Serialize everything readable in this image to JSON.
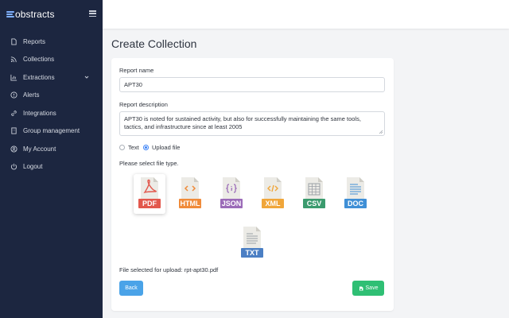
{
  "app": {
    "brand": "obstracts"
  },
  "sidebar": {
    "items": [
      {
        "label": "Reports",
        "icon": "file-icon"
      },
      {
        "label": "Collections",
        "icon": "rss-icon"
      },
      {
        "label": "Extractions",
        "icon": "flask-icon"
      },
      {
        "label": "Alerts",
        "icon": "exclamation-icon"
      },
      {
        "label": "Integrations",
        "icon": "link-icon"
      },
      {
        "label": "Group management",
        "icon": "building-icon"
      },
      {
        "label": "My Account",
        "icon": "user-circle-icon"
      },
      {
        "label": "Logout",
        "icon": "power-icon"
      }
    ]
  },
  "page": {
    "title": "Create Collection"
  },
  "form": {
    "report_name_label": "Report name",
    "report_name_value": "APT30",
    "report_description_label": "Report description",
    "report_description_lines": [
      "APT30 is noted for sustained activity, but also for successfully maintaining the same tools,",
      "tactics, and infrastructure since at least 2005"
    ],
    "radio_text_label": "Text",
    "radio_upload_label": "Upload file",
    "selected_input_mode": "Upload file",
    "file_type_prompt": "Please select file type.",
    "file_types": [
      {
        "label": "PDF",
        "color": "#e2574c"
      },
      {
        "label": "HTML",
        "color": "#f08b3a"
      },
      {
        "label": "JSON",
        "color": "#9b6bb8"
      },
      {
        "label": "XML",
        "color": "#f0a63a"
      },
      {
        "label": "CSV",
        "color": "#3b9b6e"
      },
      {
        "label": "DOC",
        "color": "#3f8fd6"
      },
      {
        "label": "TXT",
        "color": "#4b7fc4"
      }
    ],
    "selected_file_type": "PDF",
    "file_selected_text": "File selected for upload: rpt-apt30.pdf",
    "back_label": "Back",
    "save_label": "Save"
  },
  "colors": {
    "sidebar_bg": "#1c2640",
    "back_button": "#4aa3e8",
    "save_button": "#2fbf74"
  }
}
